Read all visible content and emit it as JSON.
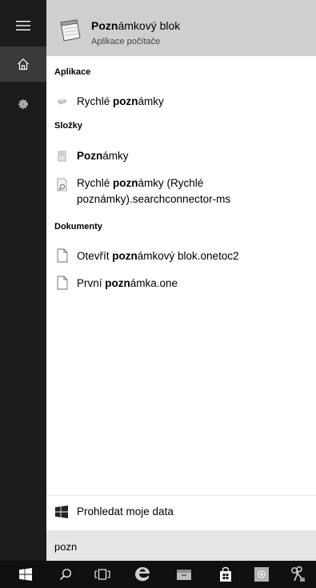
{
  "top_result": {
    "title_bold": "Pozn",
    "title_rest": "ámkový blok",
    "subtitle": "Aplikace počítače"
  },
  "sections": {
    "apps": "Aplikace",
    "folders": "Složky",
    "documents": "Dokumenty"
  },
  "apps": {
    "rychle": {
      "pre": "Rychlé ",
      "bold": "pozn",
      "post": "ámky"
    }
  },
  "folders": {
    "poznamky": {
      "bold": "Pozn",
      "post": "ámky"
    },
    "connector": {
      "pre": "Rychlé ",
      "bold": "pozn",
      "post": "ámky (Rychlé",
      "line2": "poznámky).searchconnector-ms"
    }
  },
  "documents": {
    "doc1": {
      "pre": "Otevřít ",
      "bold": "pozn",
      "post": "ámkový blok.onetoc2"
    },
    "doc2": {
      "pre": "První ",
      "bold": "pozn",
      "post": "ámka.one"
    }
  },
  "my_data": {
    "label": "Prohledat moje data"
  },
  "search": {
    "query": "pozn"
  },
  "icons": {
    "menu": "hamburger-icon",
    "home": "home-icon",
    "settings": "gear-icon",
    "start": "windows-logo-icon",
    "search": "search-icon",
    "task_view": "task-view-icon",
    "edge": "edge-icon",
    "explorer": "file-explorer-icon",
    "store": "store-icon",
    "settings_app": "settings-app-icon",
    "snipping": "snipping-tool-icon"
  },
  "colors": {
    "rail": "#1c1c1c",
    "rail_active": "#3a3a3a",
    "top_result_bg": "#cfcfcf",
    "search_bg": "#e6e6e6",
    "taskbar": "#101010"
  }
}
